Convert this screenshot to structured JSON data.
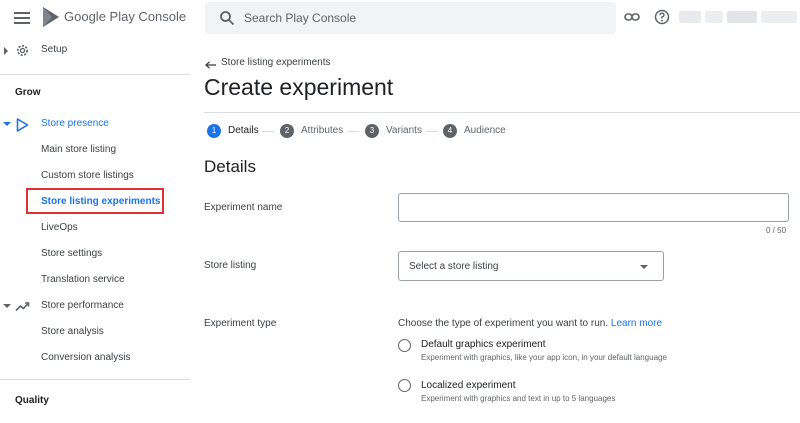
{
  "header": {
    "app_title": "Google Play Console",
    "search_placeholder": "Search Play Console"
  },
  "sidebar": {
    "setup": "Setup",
    "grow": "Grow",
    "store_presence": "Store presence",
    "store_presence_items": [
      "Main store listing",
      "Custom store listings",
      "Store listing experiments",
      "LiveOps",
      "Store settings",
      "Translation service"
    ],
    "store_performance": "Store performance",
    "store_performance_items": [
      "Store analysis",
      "Conversion analysis"
    ],
    "quality": "Quality"
  },
  "main": {
    "back_link": "Store listing experiments",
    "title": "Create experiment",
    "steps": [
      {
        "number": "1",
        "label": "Details"
      },
      {
        "number": "2",
        "label": "Attributes"
      },
      {
        "number": "3",
        "label": "Variants"
      },
      {
        "number": "4",
        "label": "Audience"
      }
    ],
    "section_title": "Details",
    "experiment_name_label": "Experiment name",
    "experiment_name_value": "",
    "char_count": "0 / 50",
    "store_listing_label": "Store listing",
    "store_listing_select": "Select a store listing",
    "experiment_type_label": "Experiment type",
    "experiment_type_intro": "Choose the type of experiment you want to run.",
    "learn_more": "Learn more",
    "options": [
      {
        "title": "Default graphics experiment",
        "description": "Experiment with graphics, like your app icon, in your default language"
      },
      {
        "title": "Localized experiment",
        "description": "Experiment with graphics and text in up to 5 languages"
      }
    ]
  },
  "colors": {
    "accent": "#1a73e8",
    "highlight": "#e03131",
    "step_active": "#1a73e8",
    "step_inactive": "#5f6368"
  }
}
